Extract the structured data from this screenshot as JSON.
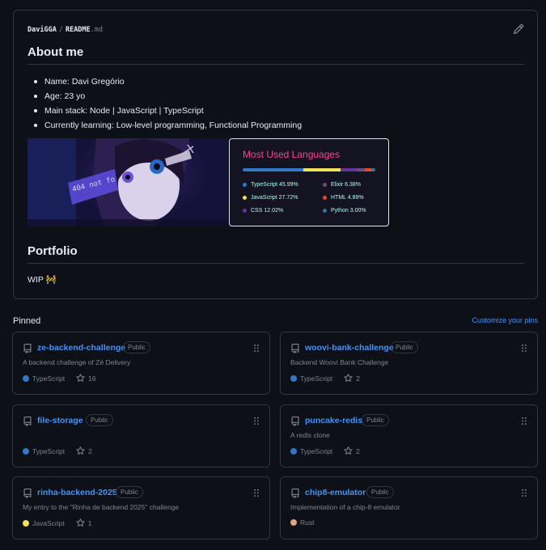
{
  "readme": {
    "owner": "DaviGGA",
    "separator": "/",
    "file_name": "README",
    "file_ext": ".md",
    "about_heading": "About me",
    "about_items": [
      "Name: Davi Gregório",
      "Age: 23 yo",
      "Main stack: Node | JavaScript | TypeScript",
      "Currently learning: Low-level programming, Functional Programming"
    ],
    "banner_text": "404 not fo",
    "portfolio_heading": "Portfolio",
    "portfolio_text": "WIP 🚧"
  },
  "languages_card": {
    "title": "Most Used Languages",
    "title_color": "#fe428e",
    "items": [
      {
        "label": "TypeScript 45.99%",
        "percent": 45.99,
        "color": "#3178c6"
      },
      {
        "label": "JavaScript 27.72%",
        "percent": 27.72,
        "color": "#f1e05a"
      },
      {
        "label": "CSS 12.02%",
        "percent": 12.02,
        "color": "#663399"
      },
      {
        "label": "Elixir 6.38%",
        "percent": 6.38,
        "color": "#6e4a7e"
      },
      {
        "label": "HTML 4.89%",
        "percent": 4.89,
        "color": "#e34c26"
      },
      {
        "label": "Python 3.00%",
        "percent": 3.0,
        "color": "#3572a5"
      }
    ]
  },
  "pinned": {
    "title": "Pinned",
    "customize_label": "Customize your pins",
    "repos": [
      {
        "name": "ze-backend-challenge",
        "visibility": "Public",
        "description": "A backend challenge of Zé Delivery",
        "language": "TypeScript",
        "language_color": "#3178c6",
        "stars": "16"
      },
      {
        "name": "woovi-bank-challenge",
        "visibility": "Public",
        "description": "Backend Woovi Bank Challenge",
        "language": "TypeScript",
        "language_color": "#3178c6",
        "stars": "2"
      },
      {
        "name": "file-storage",
        "visibility": "Public",
        "description": "",
        "language": "TypeScript",
        "language_color": "#3178c6",
        "stars": "2"
      },
      {
        "name": "puncake-redis",
        "visibility": "Public",
        "description": "A redis clone",
        "language": "TypeScript",
        "language_color": "#3178c6",
        "stars": "2"
      },
      {
        "name": "rinha-backend-2025",
        "visibility": "Public",
        "description": "My entry to the \"Rinha de backend 2025\" challenge",
        "language": "JavaScript",
        "language_color": "#f1e05a",
        "stars": "1"
      },
      {
        "name": "chip8-emulator",
        "visibility": "Public",
        "description": "Implementation of a chip-8 emulator",
        "language": "Rust",
        "language_color": "#dea584",
        "stars": ""
      }
    ]
  }
}
